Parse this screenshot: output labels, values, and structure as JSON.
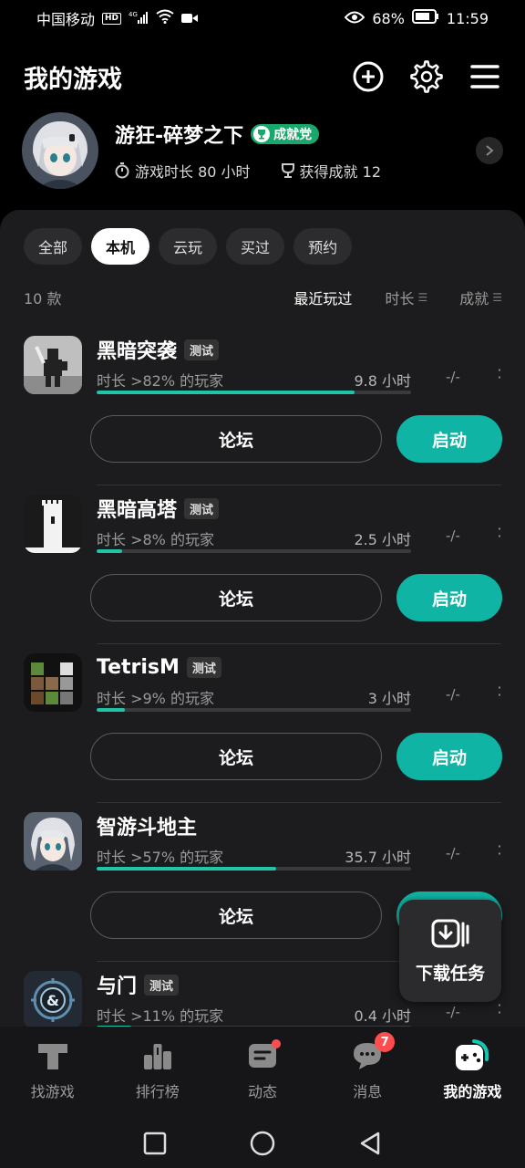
{
  "status_bar": {
    "carrier": "中国移动",
    "hd": "HD",
    "signal": "⁴ᴳ",
    "battery": "68%",
    "time": "11:59"
  },
  "header": {
    "title": "我的游戏"
  },
  "profile": {
    "name": "游狂-碎梦之下",
    "badge": "成就党",
    "playtime": "游戏时长 80 小时",
    "achievements": "获得成就 12"
  },
  "filters": [
    "全部",
    "本机",
    "云玩",
    "买过",
    "预约"
  ],
  "filters_active": "本机",
  "list_header": {
    "count": "10 款",
    "sort_recent": "最近玩过",
    "sort_duration": "时长",
    "sort_achieve": "成就"
  },
  "buttons": {
    "forum": "论坛",
    "start": "启动"
  },
  "games": [
    {
      "name": "黑暗突袭",
      "tag": "测试",
      "pct": "时长 >82% 的玩家",
      "hours": "9.8 小时",
      "progress": 0.82,
      "ach": "-/-"
    },
    {
      "name": "黑暗高塔",
      "tag": "测试",
      "pct": "时长 >8% 的玩家",
      "hours": "2.5 小时",
      "progress": 0.08,
      "ach": "-/-"
    },
    {
      "name": "TetrisM",
      "tag": "测试",
      "pct": "时长 >9% 的玩家",
      "hours": "3 小时",
      "progress": 0.09,
      "ach": "-/-"
    },
    {
      "name": "智游斗地主",
      "tag": "",
      "pct": "时长 >57% 的玩家",
      "hours": "35.7 小时",
      "progress": 0.57,
      "ach": "-/-"
    },
    {
      "name": "与门",
      "tag": "测试",
      "pct": "时长 >11% 的玩家",
      "hours": "0.4 小时",
      "progress": 0.11,
      "ach": "-/-"
    }
  ],
  "float_download": {
    "label": "下载任务"
  },
  "bottom_nav": [
    {
      "label": "找游戏",
      "icon": "taptap-logo-icon"
    },
    {
      "label": "排行榜",
      "icon": "ranking-icon"
    },
    {
      "label": "动态",
      "icon": "feed-icon"
    },
    {
      "label": "消息",
      "icon": "message-icon",
      "badge": "7"
    },
    {
      "label": "我的游戏",
      "icon": "gamepad-icon",
      "active": true
    }
  ],
  "colors": {
    "accent": "#10b4a4",
    "progress": "#21c4a7",
    "badge_green": "#18a86b",
    "notify": "#ff4d4f"
  }
}
